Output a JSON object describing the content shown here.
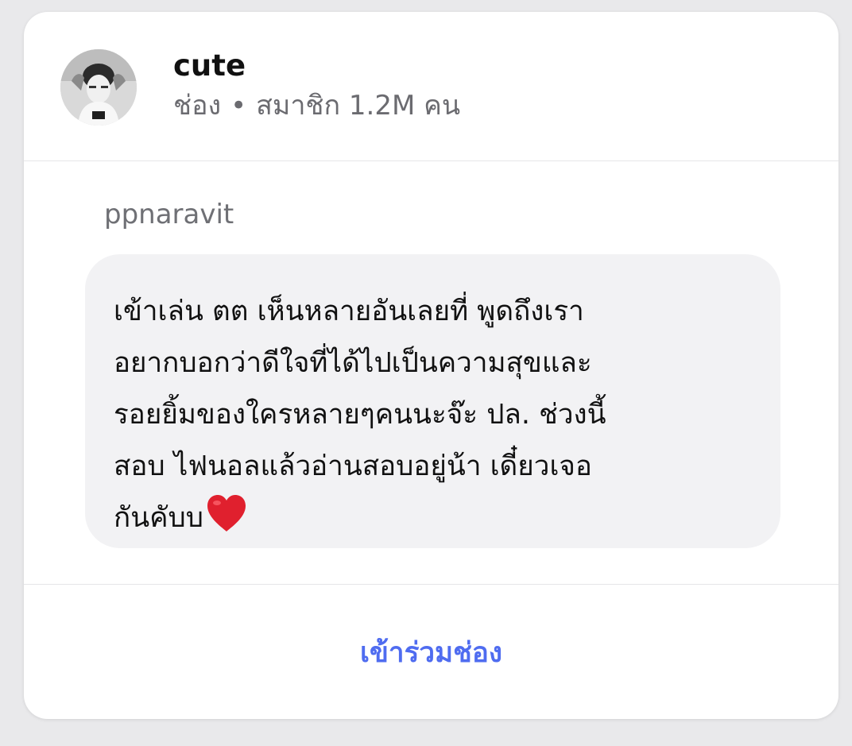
{
  "channel": {
    "name": "cute",
    "type_label": "ช่อง",
    "separator": "•",
    "members": "สมาชิก 1.2M คน"
  },
  "post": {
    "author": "ppnaravit",
    "message": "เข้าเล่น ตต เห็นหลายอันเลยที่ พูดถึงเรา\nอยากบอกว่าดีใจที่ได้ไปเป็นความสุขและ\nรอยยิ้มของใครหลายๆคนนะจ๊ะ ปล. ช่วงนี้\nสอบ ไฟนอลแล้วอ่านสอบอยู่น้า เดี๋ยวเจอ\nกันคับบ",
    "emoji": "heart-icon"
  },
  "actions": {
    "join_label": "เข้าร่วมช่อง"
  },
  "colors": {
    "accent": "#4f6cf0",
    "heart": "#e0202e",
    "bubble": "#f2f2f4"
  }
}
